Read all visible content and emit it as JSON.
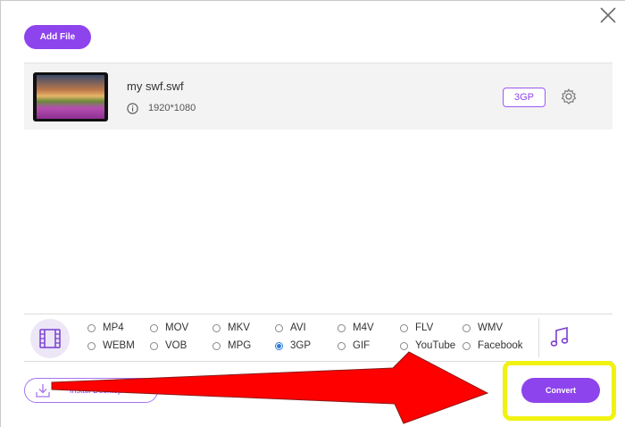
{
  "toolbar": {
    "add_file_label": "Add File"
  },
  "file": {
    "name": "my swf.swf",
    "resolution": "1920*1080",
    "format": "3GP"
  },
  "formats": {
    "video": [
      {
        "label": "MP4",
        "checked": false
      },
      {
        "label": "MOV",
        "checked": false
      },
      {
        "label": "MKV",
        "checked": false
      },
      {
        "label": "AVI",
        "checked": false
      },
      {
        "label": "M4V",
        "checked": false
      },
      {
        "label": "FLV",
        "checked": false
      },
      {
        "label": "WMV",
        "checked": false
      },
      {
        "label": "WEBM",
        "checked": false
      },
      {
        "label": "VOB",
        "checked": false
      },
      {
        "label": "MPG",
        "checked": false
      },
      {
        "label": "3GP",
        "checked": true
      },
      {
        "label": "GIF",
        "checked": false
      },
      {
        "label": "YouTube",
        "checked": false
      },
      {
        "label": "Facebook",
        "checked": false
      }
    ]
  },
  "footer": {
    "install_label": "Install Desktop Version",
    "convert_label": "Convert"
  },
  "icons": {
    "close": "close-icon",
    "info": "info-icon",
    "settings": "gear-icon",
    "video_tab": "film-icon",
    "audio_tab": "music-note-icon",
    "download": "download-icon"
  },
  "colors": {
    "accent": "#8e44ec",
    "highlight": "#f0f212",
    "arrow": "#ff0000",
    "radio_selected": "#2f7ad6"
  }
}
